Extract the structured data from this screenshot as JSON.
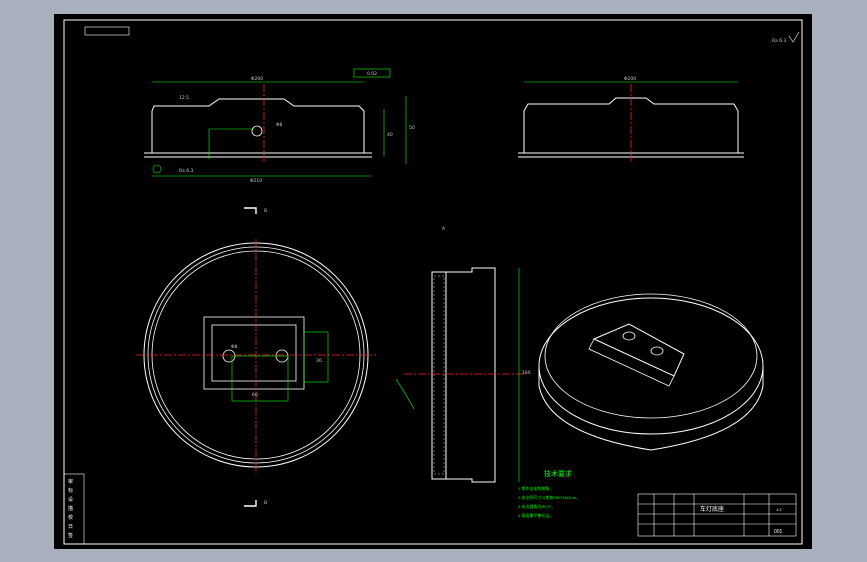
{
  "app": {
    "title": "CAD drawing viewer"
  },
  "colors": {
    "background_outer": "#a8afbd",
    "canvas": "#000000",
    "outline": "#ffffff",
    "dimension": "#00ff00",
    "centerline": "#ff0000",
    "section_label": "#ffffff"
  },
  "sheet": {
    "tech_req_title": "技术要求",
    "tech_req_items": [
      "1.零件去毛刺倒角。",
      "2.未注明尺寸公差按GB/T1804-m。",
      "3.未注圆角为R0.5°。",
      "4.表面需平整光洁。"
    ],
    "title_block": {
      "part_name": "车灯底座",
      "drawing_no": "001",
      "scale": "1:1"
    },
    "left_tags": [
      "审",
      "标",
      "设",
      "描",
      "校",
      "日",
      "签"
    ],
    "roughness": "Ra 6.3",
    "dims": {
      "top_width": "Φ200",
      "top_hole": "Φ8",
      "right_width": "Φ200",
      "height_a": "40",
      "height_b": "50",
      "flange": "Φ210",
      "section_height": "180",
      "slot": "60",
      "slot_w": "30",
      "angle": "12.5",
      "tol": "0.02"
    },
    "section_marks": [
      "B",
      "B",
      "A"
    ]
  }
}
